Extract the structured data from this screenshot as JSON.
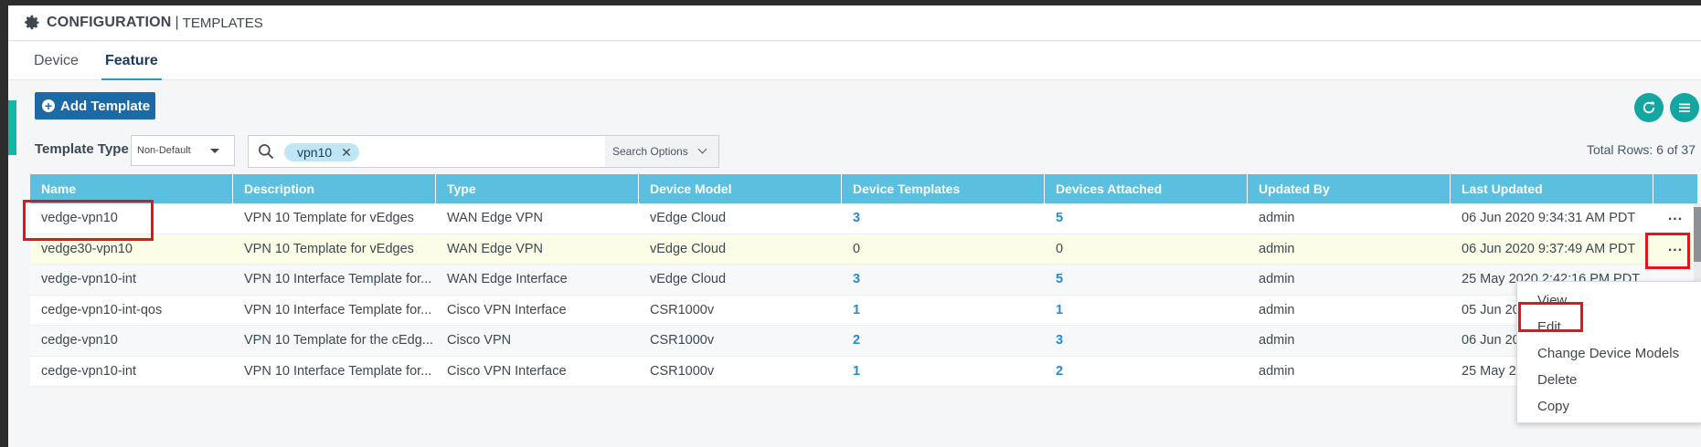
{
  "header": {
    "title": "CONFIGURATION",
    "separator": "|",
    "subtitle": "TEMPLATES"
  },
  "tabs": [
    {
      "label": "Device"
    },
    {
      "label": "Feature"
    }
  ],
  "toolbar": {
    "add_template_label": "Add Template"
  },
  "filter": {
    "template_type_label": "Template Type",
    "template_type_value": "Non-Default",
    "search_chip": "vpn10",
    "search_options_label": "Search Options"
  },
  "total_rows": "Total Rows: 6 of 37",
  "table": {
    "headers": [
      "Name",
      "Description",
      "Type",
      "Device Model",
      "Device Templates",
      "Devices Attached",
      "Updated By",
      "Last Updated"
    ],
    "rows": [
      [
        "vedge-vpn10",
        "VPN 10 Template for vEdges",
        "WAN Edge VPN",
        "vEdge Cloud",
        "3",
        "5",
        "admin",
        "06 Jun 2020 9:34:31 AM PDT"
      ],
      [
        "vedge30-vpn10",
        "VPN 10 Template for vEdges",
        "WAN Edge VPN",
        "vEdge Cloud",
        "0",
        "0",
        "admin",
        "06 Jun 2020 9:37:49 AM PDT"
      ],
      [
        "vedge-vpn10-int",
        "VPN 10 Interface Template for...",
        "WAN Edge Interface",
        "vEdge Cloud",
        "3",
        "5",
        "admin",
        "25 May 2020 2:42:16 PM PDT"
      ],
      [
        "cedge-vpn10-int-qos",
        "VPN 10 Interface Template for...",
        "Cisco VPN Interface",
        "CSR1000v",
        "1",
        "1",
        "admin",
        "05 Jun 2020"
      ],
      [
        "cedge-vpn10",
        "VPN 10 Template for the cEdg...",
        "Cisco VPN",
        "CSR1000v",
        "2",
        "3",
        "admin",
        "06 Jun 2020"
      ],
      [
        "cedge-vpn10-int",
        "VPN 10 Interface Template for...",
        "Cisco VPN Interface",
        "CSR1000v",
        "1",
        "2",
        "admin",
        "25 May 2020"
      ]
    ],
    "row_actions": "..."
  },
  "context_menu": {
    "items": [
      "View",
      "Edit",
      "Change Device Models",
      "Delete",
      "Copy"
    ]
  },
  "colors": {
    "header_bg": "#5bbfdf",
    "link": "#2b8ad0",
    "button": "#1b6aa6",
    "accent": "#14a6a0",
    "highlight": "#e0161b"
  }
}
